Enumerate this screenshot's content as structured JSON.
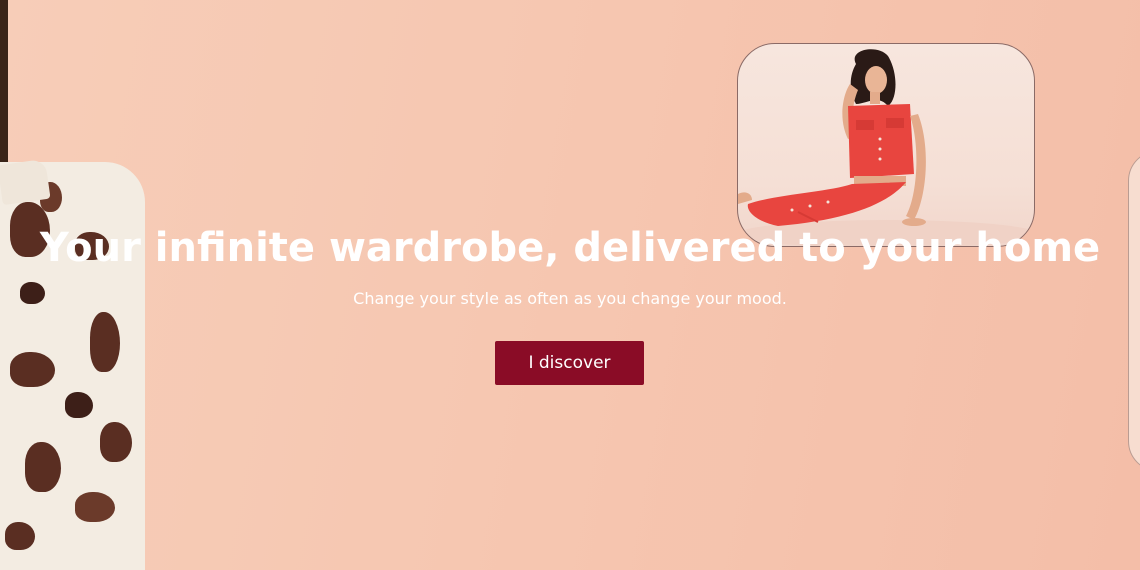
{
  "hero": {
    "title": "Your infinite wardrobe, delivered to your home",
    "subtitle": "Change your style as often as you change your mood.",
    "cta_label": "I discover"
  },
  "colors": {
    "background": "#f6c7b1",
    "cta_background": "#8a0c26",
    "text": "#ffffff",
    "outfit": "#e8453f"
  },
  "images": {
    "left": "model-cow-print-shirt",
    "card": "model-red-denim-outfit",
    "edge": "partial-card"
  }
}
